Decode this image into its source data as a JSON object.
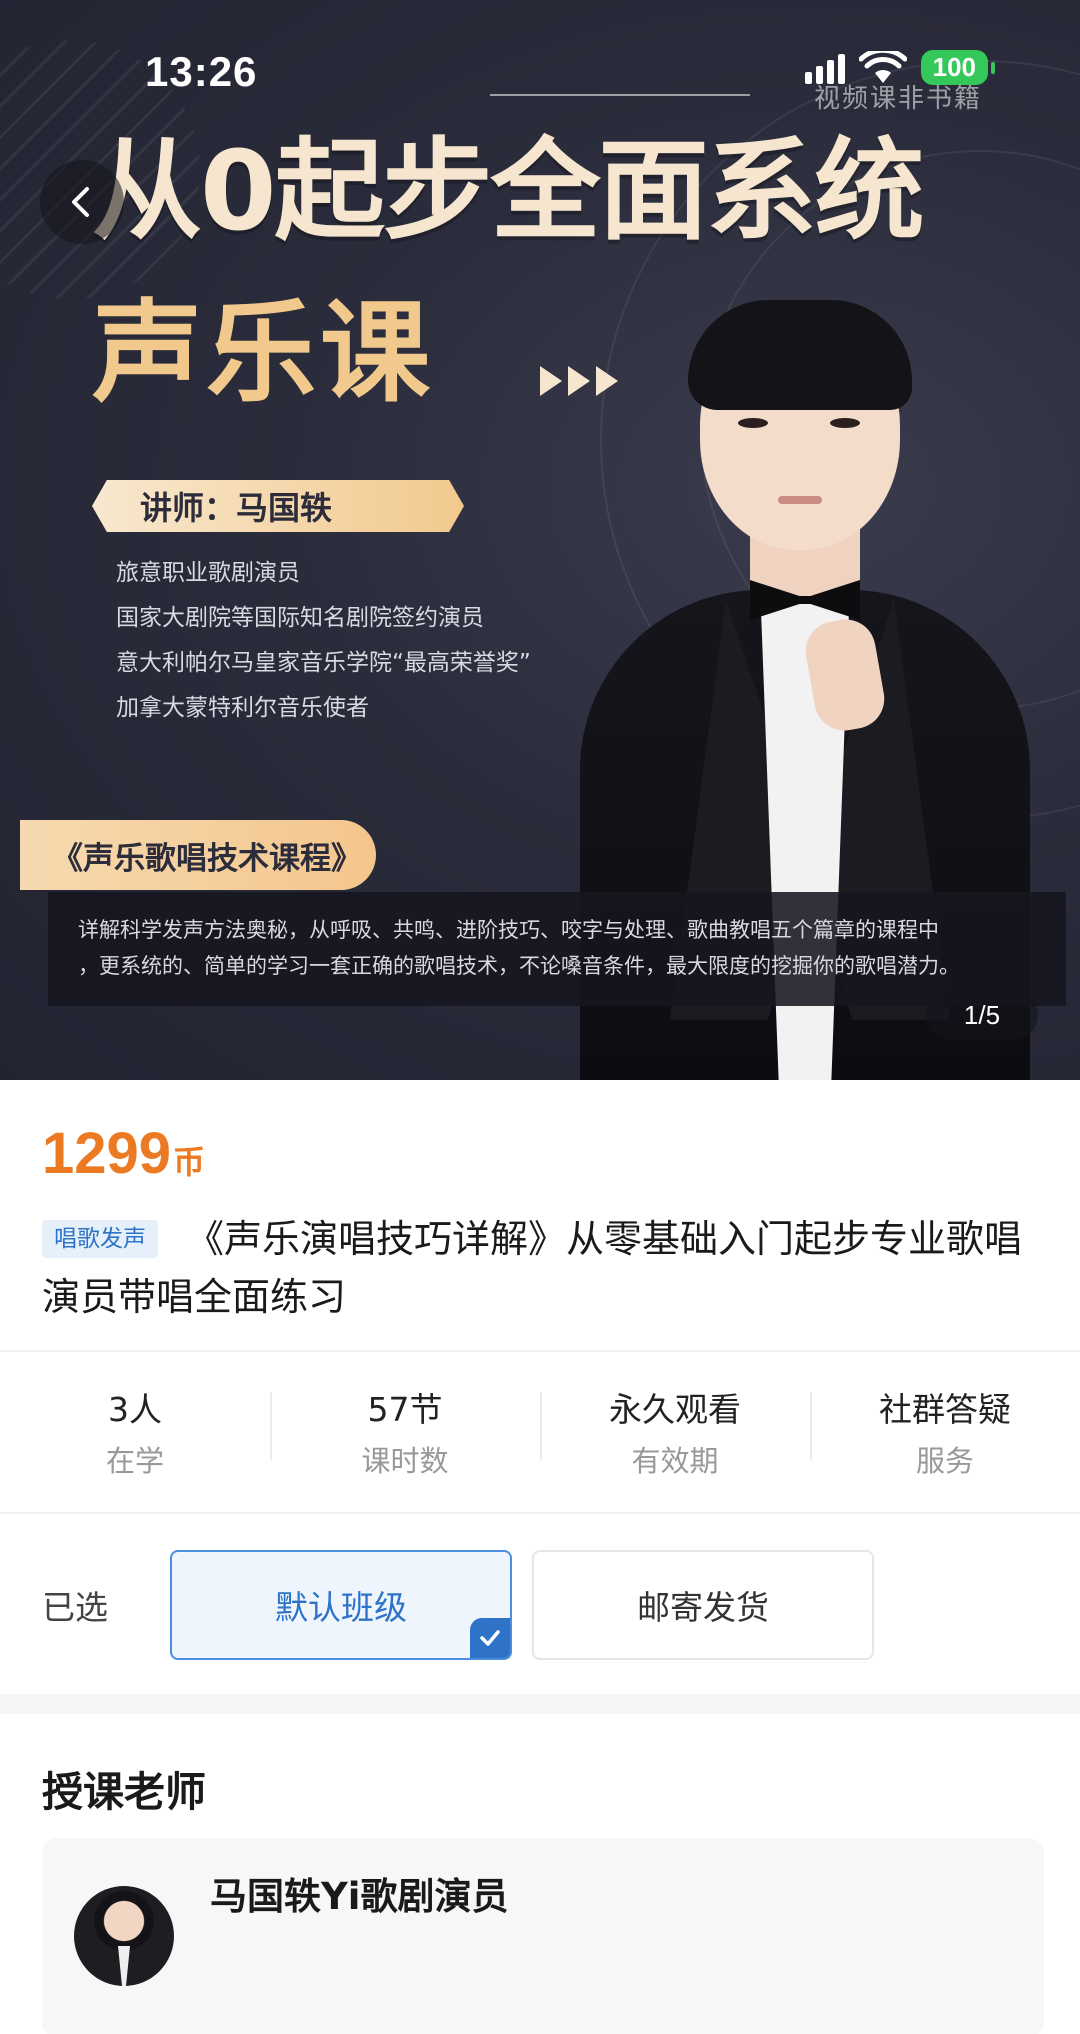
{
  "status_bar": {
    "time": "13:26",
    "battery": "100",
    "colors": {
      "battery": "#34c759"
    }
  },
  "banner": {
    "corner_tag": "视频课非书籍",
    "headline_line1": "从0起步全面系统",
    "headline_line2": "声乐课",
    "lecturer": "讲师：马国轶",
    "bio": [
      "旅意职业歌剧演员",
      "国家大剧院等国际知名剧院签约演员",
      "意大利帕尔马皇家音乐学院“最高荣誉奖”",
      "加拿大蒙特利尔音乐使者"
    ],
    "course_tag": "《声乐歌唱技术课程》",
    "description": [
      "详解科学发声方法奥秘，从呼吸、共鸣、进阶技巧、咬字与处理、歌曲教唱五个篇章的课程中",
      "，更系统的、简单的学习一套正确的歌唱技术，不论嗓音条件，最大限度的挖掘你的歌唱潜力。"
    ],
    "page_indicator": "1/5",
    "icons": {
      "back": "back-arrow-icon",
      "forward_arrows": "triple-arrow-icon"
    }
  },
  "product": {
    "price": "1299",
    "price_unit": "币",
    "category": "唱歌发声",
    "title": "《声乐演唱技巧详解》从零基础入门起步专业歌唱演员带唱全面练习",
    "colors": {
      "price": "#ec7a22",
      "accent": "#2e73c8"
    }
  },
  "stats": [
    {
      "value": "3人",
      "label": "在学"
    },
    {
      "value": "57节",
      "label": "课时数"
    },
    {
      "value": "永久观看",
      "label": "有效期"
    },
    {
      "value": "社群答疑",
      "label": "服务"
    }
  ],
  "options": {
    "label": "已选",
    "items": [
      {
        "label": "默认班级",
        "selected": true
      },
      {
        "label": "邮寄发货",
        "selected": false
      }
    ]
  },
  "teacher_section": {
    "heading": "授课老师",
    "name": "马国轶Yi歌剧演员"
  }
}
